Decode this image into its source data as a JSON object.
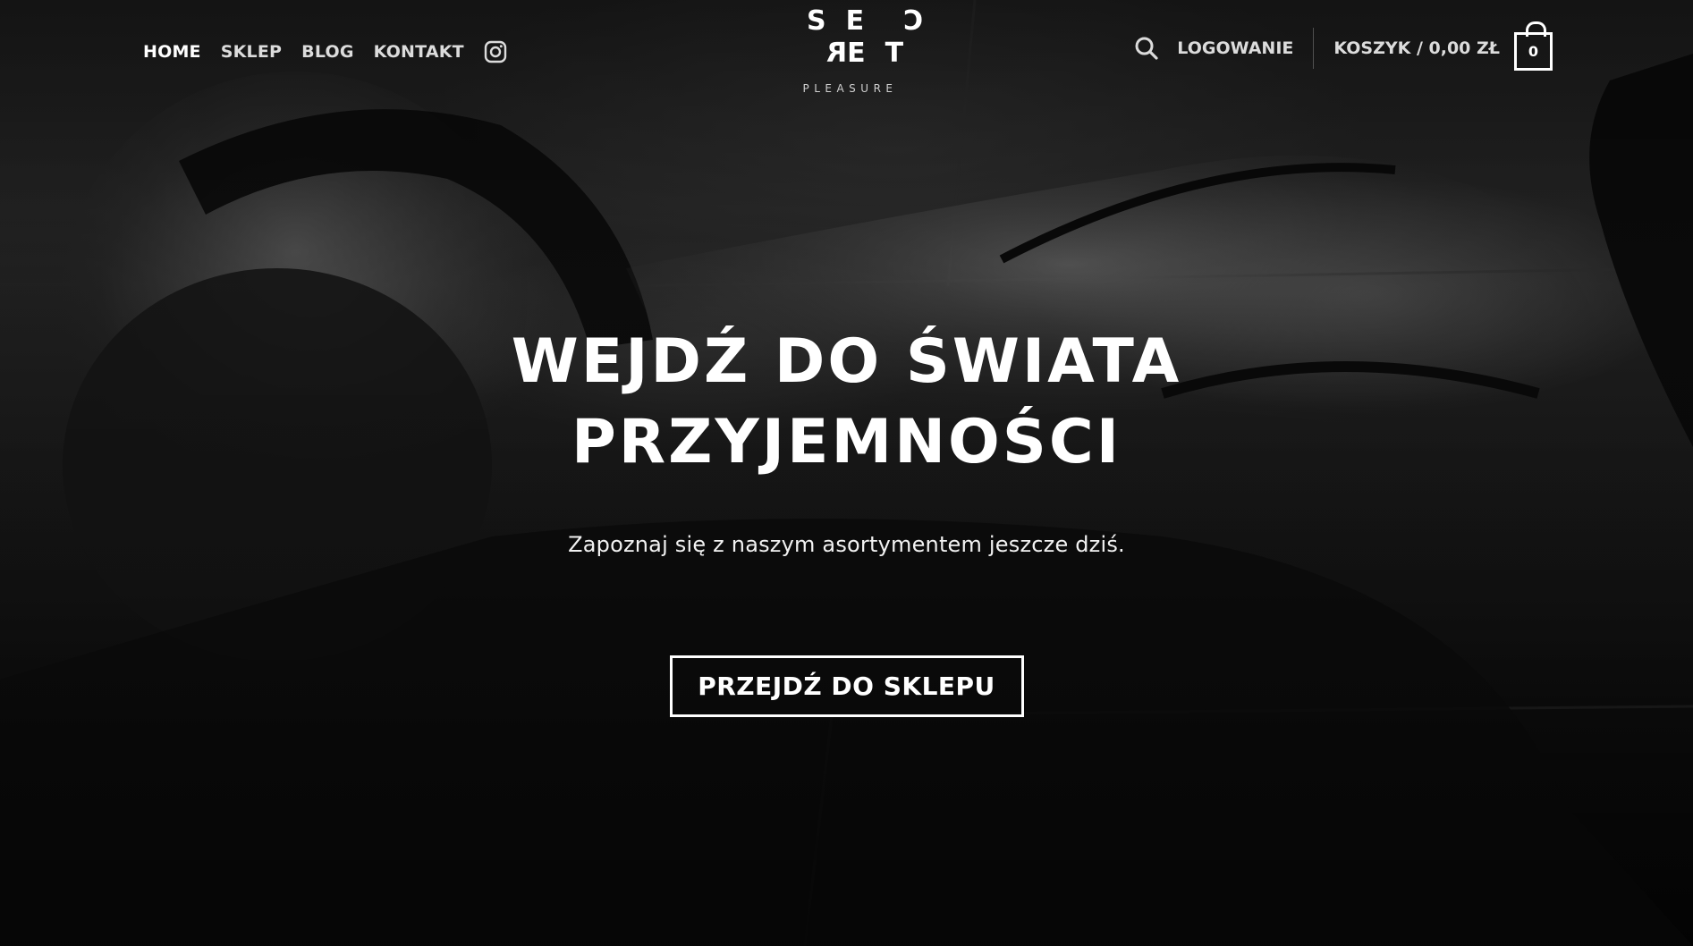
{
  "header": {
    "nav": [
      {
        "label": "HOME",
        "active": true
      },
      {
        "label": "SKLEP",
        "active": false
      },
      {
        "label": "BLOG",
        "active": false
      },
      {
        "label": "KONTAKT",
        "active": false
      }
    ],
    "instagram_icon": "instagram-icon",
    "logo": {
      "row1": [
        "S",
        "E",
        "C"
      ],
      "row2": [
        "R",
        "E",
        "T"
      ],
      "subtitle": "PLEASURE"
    },
    "search_icon": "search-icon",
    "login_label": "LOGOWANIE",
    "cart_label": "KOSZYK / 0,00 ZŁ",
    "cart_count": "0"
  },
  "hero": {
    "title_line1": "WEJDŹ DO ŚWIATA",
    "title_line2": "PRZYJEMNOŚCI",
    "subtitle": "Zapoznaj się z naszym asortymentem jeszcze dziś.",
    "cta_label": "PRZEJDŹ DO SKLEPU"
  },
  "colors": {
    "text": "#ffffff",
    "nav_text": "#dcdcdc",
    "background": "#111111"
  }
}
